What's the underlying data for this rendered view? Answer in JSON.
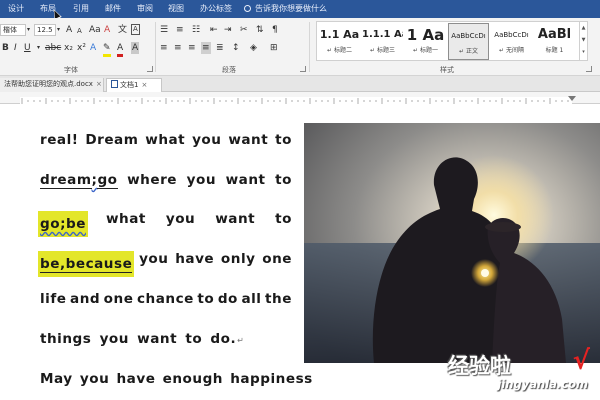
{
  "menu": {
    "items": [
      "设计",
      "布局",
      "引用",
      "邮件",
      "审阅",
      "视图",
      "办公标签"
    ],
    "tell_me": "告诉我你想要做什么"
  },
  "ribbon": {
    "font_name": "楷体",
    "font_size": "12.5",
    "font_group_label": "字体",
    "paragraph_group_label": "段落",
    "styles_group_label": "样式",
    "styles": [
      {
        "sample": "1.1 Aa",
        "name": "标题二",
        "selected": false
      },
      {
        "sample": "1.1.1 Aa",
        "name": "标题三",
        "selected": false
      },
      {
        "sample": "1 Aa",
        "name": "标题一",
        "selected": false
      },
      {
        "sample": "AaBbCcDı",
        "name": "正文",
        "selected": true
      },
      {
        "sample": "AaBbCcDı",
        "name": "无间隔",
        "selected": false
      },
      {
        "sample": "AaBl",
        "name": "标题 1",
        "selected": false
      }
    ]
  },
  "tabs": [
    {
      "label": "法帮助您证明您的观点.docx",
      "close": "×"
    },
    {
      "label": "文档1",
      "close": "×"
    }
  ],
  "document": {
    "line1": [
      "real!",
      "Dream",
      "what",
      "you",
      "want",
      "to"
    ],
    "line2": {
      "word1": "dream",
      "sep": ";",
      "word2": "go",
      "rest": [
        "where",
        "you",
        "want",
        "to"
      ]
    },
    "line3": {
      "highlight": "go;be",
      "rest": [
        "what",
        "you",
        "want",
        "to"
      ]
    },
    "line4": {
      "highlight": "be,because",
      "rest": [
        "you",
        "have",
        "only",
        "one"
      ]
    },
    "line5": [
      "life",
      "and",
      "one",
      "chance",
      "to",
      "do",
      "all",
      "the"
    ],
    "line6": "things you want to do.",
    "line7": "May you have enough happiness",
    "para_mark": "↵"
  },
  "watermark": {
    "text_cn": "经验啦",
    "check": "√",
    "url": "jingyanla.com"
  },
  "colors": {
    "menu_bar": "#2b579a",
    "highlight": "#e3e62a",
    "watermark_check": "#e52222"
  }
}
